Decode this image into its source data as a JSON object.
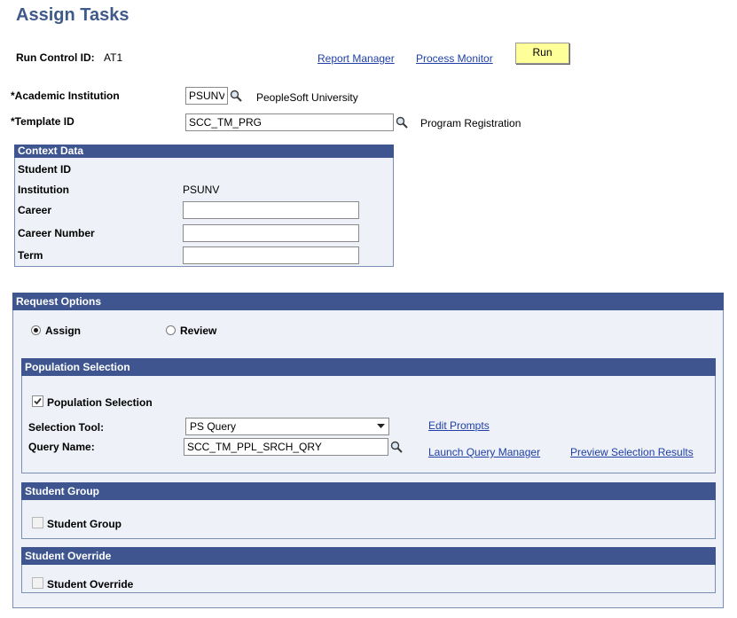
{
  "page": {
    "title": "Assign Tasks"
  },
  "header": {
    "run_control_label": "Run Control ID:",
    "run_control_value": "AT1",
    "report_manager": "Report Manager",
    "process_monitor": "Process Monitor",
    "run_label": "Run"
  },
  "form": {
    "institution_label": "*Academic Institution",
    "institution_value": "PSUNV",
    "institution_desc": "PeopleSoft University",
    "template_label": "*Template ID",
    "template_value": "SCC_TM_PRG",
    "template_desc": "Program Registration"
  },
  "context": {
    "title": "Context Data",
    "student_id_label": "Student ID",
    "institution_label": "Institution",
    "institution_value": "PSUNV",
    "career_label": "Career",
    "career_value": "",
    "career_number_label": "Career Number",
    "career_number_value": "",
    "term_label": "Term",
    "term_value": ""
  },
  "request": {
    "title": "Request Options",
    "assign_label": "Assign",
    "review_label": "Review",
    "selected": "Assign"
  },
  "population": {
    "title": "Population Selection",
    "checkbox_label": "Population Selection",
    "checked": true,
    "tool_label": "Selection Tool:",
    "tool_value": "PS Query",
    "query_label": "Query Name:",
    "query_value": "SCC_TM_PPL_SRCH_QRY",
    "edit_prompts": "Edit Prompts",
    "launch_query_manager": "Launch Query Manager",
    "preview_results": "Preview Selection Results"
  },
  "student_group": {
    "title": "Student Group",
    "checkbox_label": "Student Group",
    "checked": false
  },
  "student_override": {
    "title": "Student Override",
    "checkbox_label": "Student Override",
    "checked": false
  },
  "colors": {
    "header_bar": "#3e5590",
    "title": "#3f5a8a",
    "run_button": "#ffff99",
    "link": "#1f3fa6"
  }
}
